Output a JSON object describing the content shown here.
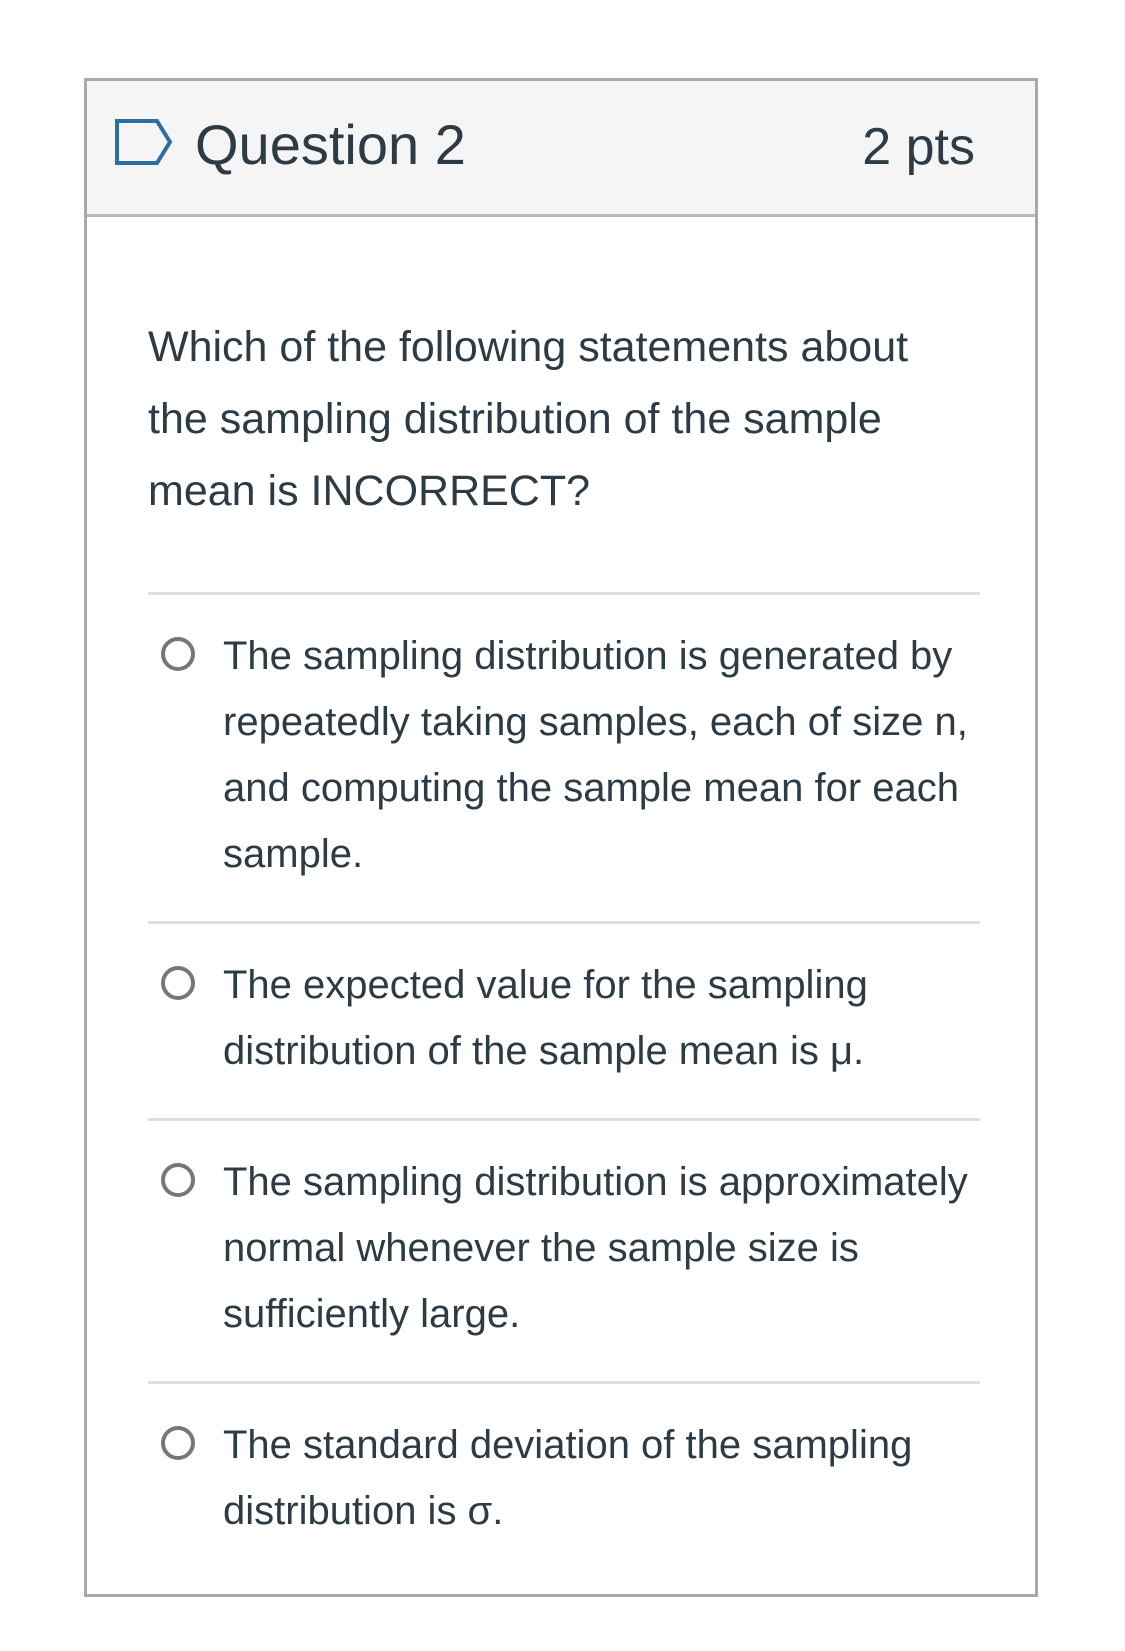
{
  "question": {
    "title": "Question 2",
    "points": "2 pts",
    "flag_icon": "flag-outline-icon",
    "text": "Which of the following statements about the sampling distribution of the sample mean is INCORRECT?"
  },
  "answers": [
    {
      "label": "The sampling distribution is generated by repeatedly taking samples, each of size n, and computing the sample mean for each sample.",
      "selected": false
    },
    {
      "label": "The expected value for the sampling distribution of the sample mean is μ.",
      "selected": false
    },
    {
      "label": "The sampling distribution is approximately normal whenever the sample size is sufficiently large.",
      "selected": false
    },
    {
      "label": "The standard deviation of the sampling distribution is σ.",
      "selected": false
    }
  ],
  "colors": {
    "text": "#2d3b45",
    "header_bg": "#f5f5f5",
    "border": "#a8a9ab",
    "divider": "#dcdedf",
    "radio_border": "#73787c",
    "flag_stroke": "#2d6fa0"
  }
}
